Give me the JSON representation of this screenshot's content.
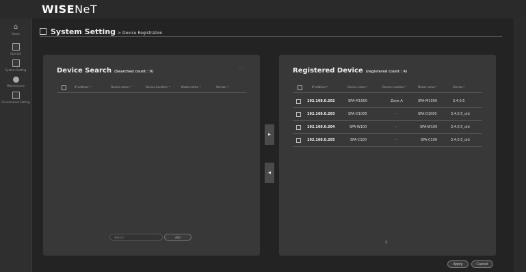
{
  "brand": {
    "bold": "WISE",
    "thin": "NeT"
  },
  "sidebar": {
    "items": [
      {
        "label": "Home",
        "icon": "home-icon"
      },
      {
        "label": "Operate",
        "icon": "operate-icon"
      },
      {
        "label": "System Setting",
        "icon": "system-setting-icon"
      },
      {
        "label": "Maintenance",
        "icon": "maintenance-icon"
      },
      {
        "label": "Environment Setting",
        "icon": "environment-setting-icon"
      }
    ]
  },
  "page": {
    "title": "System Setting",
    "breadcrumb": "> Device Registration"
  },
  "device_search": {
    "title": "Device Search",
    "count": "(Searched count : 0)",
    "columns": [
      "IP address",
      "Device name",
      "Device Location",
      "Model name",
      "Version"
    ],
    "search_placeholder": "Search",
    "add_label": "Add"
  },
  "registered_device": {
    "title": "Registered Device",
    "count": "(registered count : 4)",
    "columns": [
      "IP address",
      "Device name",
      "Device Location",
      "Model name",
      "Version"
    ],
    "rows": [
      {
        "ip": "192.168.0.202",
        "device": "SPA-M1000",
        "location": "Zone A",
        "model": "SPA-M1000",
        "version": "3.4.0.5"
      },
      {
        "ip": "192.168.0.203",
        "device": "SPA-D1000",
        "location": "-",
        "model": "SPA-D1000",
        "version": "3.4.0.5_old"
      },
      {
        "ip": "192.168.0.204",
        "device": "SPA-W100",
        "location": "-",
        "model": "SPA-W100",
        "version": "3.4.0.5_old"
      },
      {
        "ip": "192.168.0.205",
        "device": "SPA-C100",
        "location": "-",
        "model": "SPA-C100",
        "version": "3.4.0.5_old"
      }
    ],
    "page": "1"
  },
  "transfer": {
    "right": "▶",
    "left": "◀"
  },
  "actions": {
    "apply": "Apply",
    "cancel": "Cancel"
  },
  "sort_glyph": "⌃"
}
